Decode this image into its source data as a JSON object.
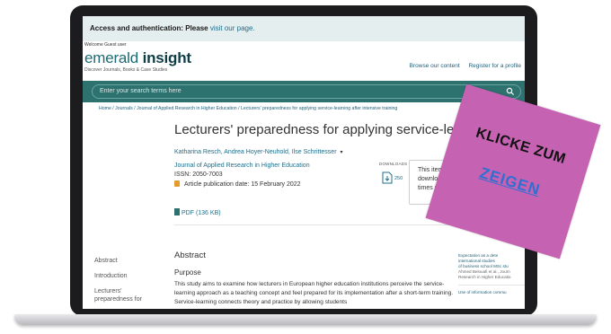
{
  "access_bar": {
    "label": "Access and authentication: Please ",
    "link": "visit our page."
  },
  "welcome": "Welcome Guest user",
  "logo": {
    "part1": "emerald",
    "part2": "insight",
    "tagline": "Discover Journals, Books & Case Studies"
  },
  "top_nav": {
    "browse": "Browse our content",
    "register": "Register for a profile"
  },
  "search": {
    "placeholder": "Enter your search terms here",
    "icon": "search-icon"
  },
  "breadcrumb": "Home  /  Journals  /  Journal of Applied Research in Higher Education  /  Lecturers' preparedness for applying service-learning after intensive training",
  "article": {
    "title": "Lecturers' preparedness for applying service-learning after",
    "authors": "Katharina Resch, Andrea Hoyer-Neuhold, Ilse Schrittesser",
    "authors_caret": "▾",
    "journal": "Journal of Applied Research in Higher Education",
    "issn": "ISSN: 2050-7003",
    "pubdate": "Article publication date: 15 February 2022"
  },
  "downloads": {
    "label": "DOWNLOADS",
    "count": "250"
  },
  "tooltip": {
    "line1": "This item has b",
    "line2": "downloaded",
    "line3": "times since"
  },
  "pdf": {
    "label": "PDF (136 KB)"
  },
  "side_nav": [
    "Abstract",
    "Introduction",
    "Lecturers'",
    "preparedness for"
  ],
  "abstract": {
    "heading": "Abstract",
    "purpose": "Purpose",
    "text": "This study aims to examine how lecturers in European higher education institutions perceive the service-learning approach as a teaching concept and feel prepared for its implementation after a short-term training. Service-learning connects theory and practice by allowing students"
  },
  "related": {
    "line1": "Expectation as a dete",
    "line2": "international studies",
    "line3": "of business school MSc stu",
    "line4": "Ahmed Belouafi et al., Journ",
    "line5": "Research in Higher Educatio",
    "line6": "Use of information commu"
  },
  "sticker": {
    "line1": "KLICKE ZUM",
    "line2": "ZEIGEN"
  }
}
